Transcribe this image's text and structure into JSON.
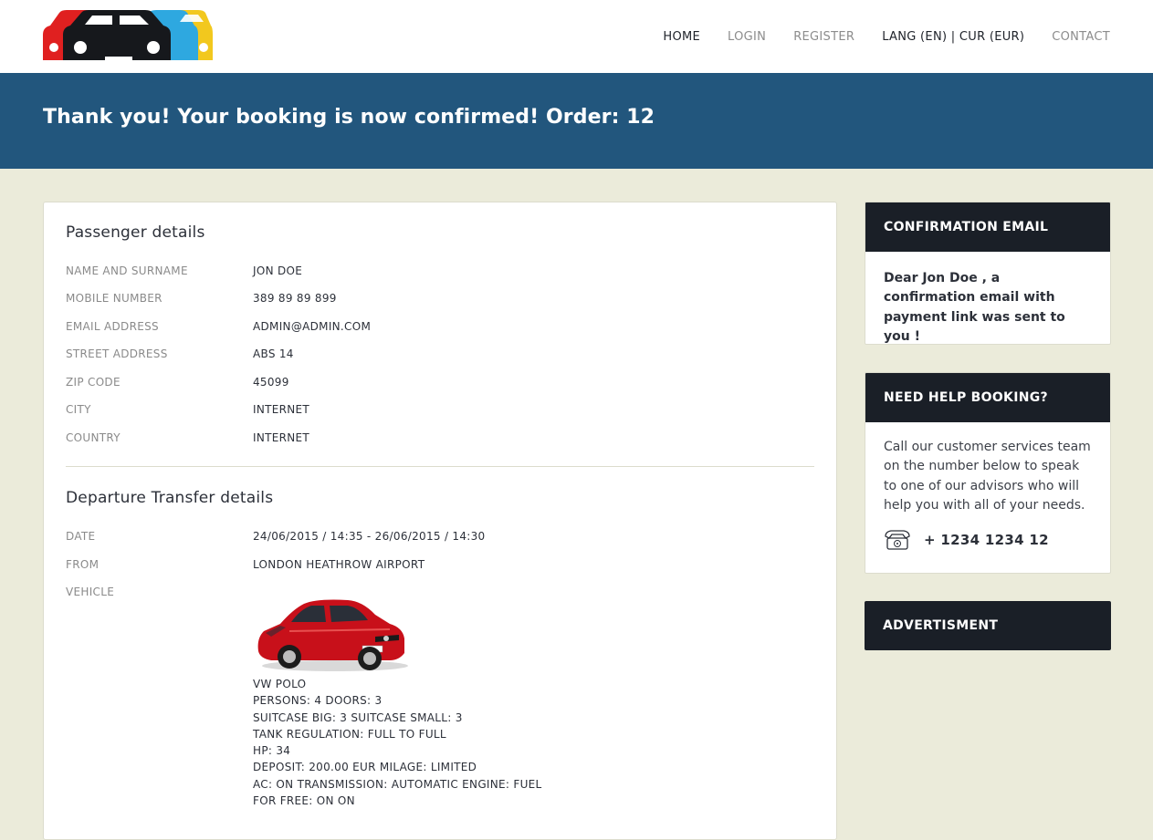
{
  "nav": {
    "home": "HOME",
    "login": "LOGIN",
    "register": "REGISTER",
    "lang_cur": "LANG (EN) | CUR (EUR)",
    "contact": "CONTACT"
  },
  "banner": {
    "title": "Thank you! Your booking is now confirmed! Order: 12"
  },
  "passenger": {
    "title": "Passenger details",
    "rows": [
      {
        "label": "NAME AND SURNAME",
        "value": "JON DOE"
      },
      {
        "label": "MOBILE NUMBER",
        "value": "389 89 89 899"
      },
      {
        "label": "EMAIL ADDRESS",
        "value": "ADMIN@ADMIN.COM"
      },
      {
        "label": "STREET ADDRESS",
        "value": "ABS 14"
      },
      {
        "label": "ZIP CODE",
        "value": "45099"
      },
      {
        "label": "CITY",
        "value": "INTERNET"
      },
      {
        "label": "COUNTRY",
        "value": "INTERNET"
      }
    ]
  },
  "departure": {
    "title": "Departure Transfer details",
    "date_label": "DATE",
    "date_value": "24/06/2015 / 14:35 - 26/06/2015 / 14:30",
    "from_label": "FROM",
    "from_value": "LONDON HEATHROW AIRPORT",
    "vehicle_label": "VEHICLE",
    "vehicle_specs": [
      "VW POLO",
      "PERSONS: 4 DOORS: 3",
      "SUITCASE BIG: 3 SUITCASE SMALL: 3",
      "TANK REGULATION: FULL TO FULL",
      "HP: 34",
      "DEPOSIT: 200.00 EUR MILAGE: LIMITED",
      "AC: ON TRANSMISSION: AUTOMATIC ENGINE: FUEL",
      "FOR FREE: ON ON"
    ]
  },
  "sidebar": {
    "confirmation": {
      "title": "CONFIRMATION EMAIL",
      "text": "Dear Jon Doe , a confirmation email with payment link was sent to you !"
    },
    "help": {
      "title": "NEED HELP BOOKING?",
      "text": "Call our customer services team on the number below to speak to one of our advisors who will help you with all of your needs.",
      "phone": "+ 1234 1234 12"
    },
    "ad": {
      "title": "ADVERTISMENT"
    }
  },
  "colors": {
    "banner": "#22567d",
    "page_bg": "#ebebda",
    "side_header": "#1a1f27",
    "logo_red": "#e02020",
    "logo_blue": "#2ea8e0",
    "logo_yellow": "#f2c81e",
    "logo_black": "#16181c",
    "car_red": "#c8101a"
  },
  "icons": {
    "logo": "car-logo-icon",
    "phone": "telephone-icon",
    "car": "vw-polo-car-image"
  }
}
